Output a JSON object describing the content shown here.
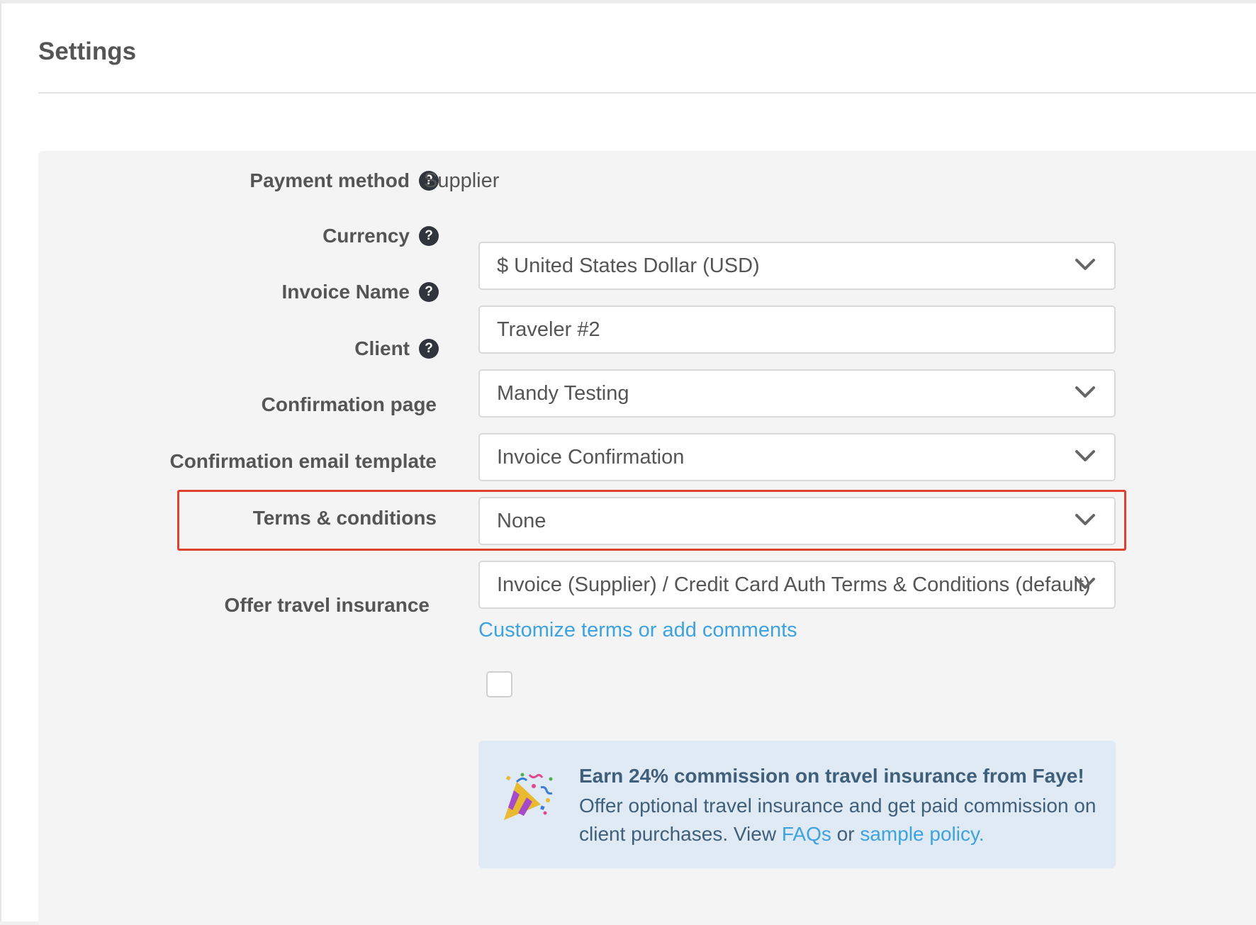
{
  "page": {
    "title": "Settings"
  },
  "form": {
    "payment_method": {
      "label": "Payment method",
      "value": "Supplier"
    },
    "currency": {
      "label": "Currency",
      "value": "$ United States Dollar (USD)"
    },
    "invoice_name": {
      "label": "Invoice Name",
      "value": "Traveler #2"
    },
    "client": {
      "label": "Client",
      "value": "Mandy Testing"
    },
    "confirmation_page": {
      "label": "Confirmation page",
      "value": "Invoice Confirmation"
    },
    "confirmation_email_template": {
      "label": "Confirmation email template",
      "value": "None",
      "highlighted": true
    },
    "terms": {
      "label": "Terms & conditions",
      "value": "Invoice (Supplier) / Credit Card Auth Terms & Conditions (default)",
      "customize_link": "Customize terms or add comments"
    },
    "travel_insurance": {
      "label": "Offer travel insurance",
      "checked": false
    }
  },
  "help_icon_glyph": "?",
  "promo": {
    "icon": "party-popper-icon",
    "title": "Earn 24% commission on travel insurance from Faye!",
    "body_prefix": "Offer optional travel insurance and get paid commission on client purchases. View ",
    "faqs_link": "FAQs",
    "connector": " or ",
    "policy_link": "sample policy."
  },
  "colors": {
    "highlight": "#e0412f",
    "link": "#3ea2de",
    "promo_bg": "#dfeaf4",
    "promo_text": "#3f5f7a",
    "panel_bg": "#f4f4f4"
  }
}
